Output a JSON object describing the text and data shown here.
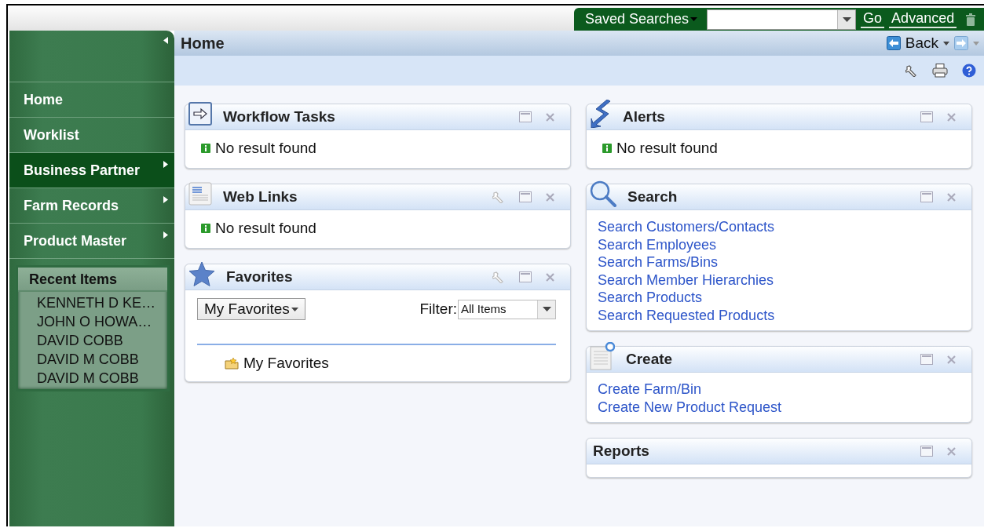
{
  "top_bar": {
    "saved_searches": "Saved Searches",
    "go": "Go",
    "advanced": "Advanced"
  },
  "sidebar": {
    "items": [
      {
        "label": "Home",
        "selected": false,
        "submenu": false
      },
      {
        "label": "Worklist",
        "selected": false,
        "submenu": false
      },
      {
        "label": "Business Partner",
        "selected": true,
        "submenu": true
      },
      {
        "label": "Farm Records",
        "selected": false,
        "submenu": true
      },
      {
        "label": "Product Master",
        "selected": false,
        "submenu": true
      }
    ],
    "recent": {
      "title": "Recent Items",
      "items": [
        "KENNETH D KE…",
        "JOHN O HOWA…",
        "DAVID COBB",
        "DAVID M COBB",
        "DAVID M COBB"
      ]
    }
  },
  "page": {
    "title": "Home",
    "back": "Back"
  },
  "columns": [
    [
      {
        "title": "Workflow Tasks",
        "settings": false,
        "body": {
          "kind": "message",
          "text": "No result found"
        }
      },
      {
        "title": "Web Links",
        "settings": true,
        "body": {
          "kind": "message",
          "text": "No result found"
        }
      },
      {
        "title": "Favorites",
        "settings": true,
        "body": {
          "kind": "favorites",
          "dropdown": "My Favorites",
          "filter_label": "Filter:",
          "filter_value": "All Items",
          "tree_item": "My Favorites"
        }
      }
    ],
    [
      {
        "title": "Alerts",
        "settings": false,
        "body": {
          "kind": "message",
          "text": "No result found"
        }
      },
      {
        "title": "Search",
        "settings": false,
        "body": {
          "kind": "links",
          "links": [
            "Search Customers/Contacts",
            "Search Employees",
            "Search Farms/Bins",
            "Search Member Hierarchies",
            "Search Products",
            "Search Requested Products"
          ]
        }
      },
      {
        "title": "Create",
        "settings": false,
        "body": {
          "kind": "links",
          "links": [
            "Create Farm/Bin",
            "Create New Product Request"
          ]
        }
      },
      {
        "title": "Reports",
        "settings": false,
        "body": {
          "kind": "empty"
        }
      }
    ]
  ]
}
